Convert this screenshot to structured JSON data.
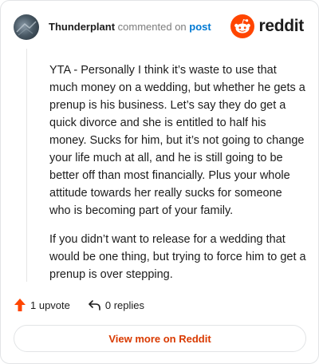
{
  "header": {
    "username": "Thunderplant",
    "action_text": "commented on",
    "post_link": "post",
    "logo_text": "reddit"
  },
  "comment": {
    "paragraphs": [
      "YTA - Personally I think it’s waste to use that much money on a wedding, but whether he gets a prenup is his business. Let’s say they do get a quick divorce and she is entitled to half his money. Sucks for him, but it’s not going to change your life much at all, and he is still going to be better off than most financially. Plus your whole attitude towards her really sucks for someone who is becoming part of your family.",
      "If you didn’t want to release for a wedding that would be one thing, but trying to force him to get a prenup is over stepping."
    ]
  },
  "actions": {
    "upvotes": "1 upvote",
    "replies": "0 replies"
  },
  "footer": {
    "view_button": "View more on Reddit"
  },
  "colors": {
    "brand_orange": "#ff4500",
    "link_blue": "#0079d3",
    "view_button_text": "#d93a00"
  },
  "icons": {
    "avatar": "user-avatar",
    "logo": "reddit-snoo-icon",
    "upvote": "upvote-arrow-icon",
    "reply": "reply-arrow-icon"
  }
}
